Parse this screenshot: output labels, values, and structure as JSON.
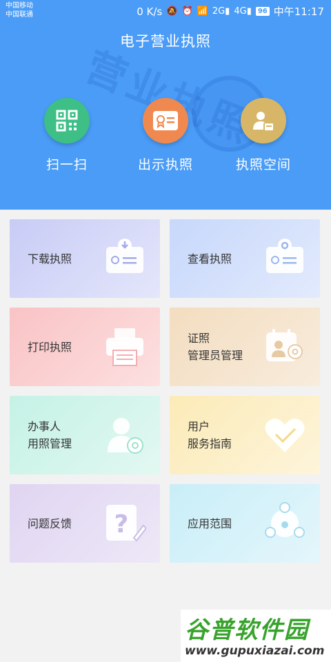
{
  "status_bar": {
    "carrier_1": "中国移动",
    "carrier_2": "中国联通",
    "network_speed": "0 K/s",
    "signal_2g": "2G",
    "signal_4g": "4G",
    "battery": "96",
    "time": "中午11:17"
  },
  "header": {
    "title": "电子营业执照",
    "watermark": "营业执照"
  },
  "quick_actions": [
    {
      "label": "扫一扫",
      "icon": "qr-code-icon",
      "color": "#3dbf86"
    },
    {
      "label": "出示执照",
      "icon": "license-card-icon",
      "color": "#f0894f"
    },
    {
      "label": "执照空间",
      "icon": "user-badge-icon",
      "color": "#d7b767"
    }
  ],
  "cards": [
    {
      "lines": [
        "下载执照"
      ],
      "icon": "download-license-icon"
    },
    {
      "lines": [
        "查看执照"
      ],
      "icon": "view-license-icon"
    },
    {
      "lines": [
        "打印执照"
      ],
      "icon": "printer-icon"
    },
    {
      "lines": [
        "证照",
        "管理员管理"
      ],
      "icon": "admin-settings-icon"
    },
    {
      "lines": [
        "办事人",
        "用照管理"
      ],
      "icon": "person-settings-icon"
    },
    {
      "lines": [
        "用户",
        "服务指南"
      ],
      "icon": "heart-icon"
    },
    {
      "lines": [
        "问题反馈"
      ],
      "icon": "question-feedback-icon"
    },
    {
      "lines": [
        "应用范围"
      ],
      "icon": "scope-nodes-icon"
    }
  ],
  "site_watermark": {
    "logo": "谷普软件园",
    "url": "www.gupuxiazai.com"
  }
}
